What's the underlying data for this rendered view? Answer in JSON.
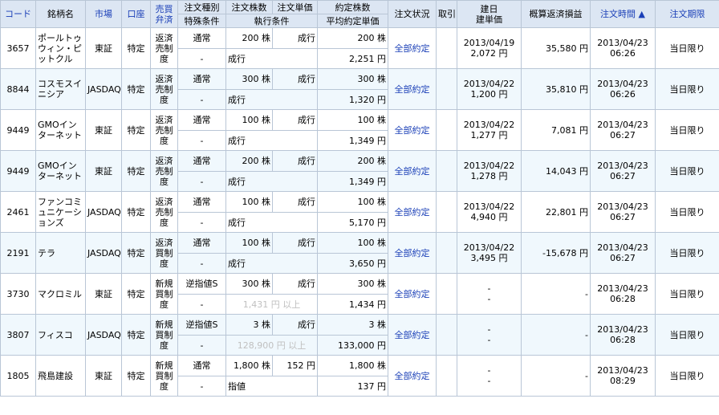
{
  "header": {
    "code": "コード",
    "name": "銘柄名",
    "market": "市場",
    "account": "口座",
    "trade": "売買弁済",
    "order_type": "注文種別",
    "order_qty": "注文株数",
    "order_price": "注文単価",
    "exec_qty": "約定株数",
    "status": "注文状況",
    "cancel": "取引",
    "open_date": "建日",
    "open_price": "建単価",
    "profit": "概算返済損益",
    "order_time": "注文時間 ▲",
    "expiry": "注文期限",
    "special": "特殊条件",
    "exec_cond": "執行条件",
    "avg_price": "平均約定単価"
  },
  "rows": [
    {
      "code": "3657",
      "name": "ポールトゥウィン・ピットクル",
      "market": "東証",
      "account": "特定",
      "trade": "返済売制度",
      "type": "通常",
      "qty": "200 株",
      "price": "成行",
      "exec_qty": "200 株",
      "special": "-",
      "cond": "成行",
      "avg": "2,251 円",
      "status": "全部約定",
      "open_date": "2013/04/19",
      "open_price": "2,072 円",
      "profit": "35,580 円",
      "time_d": "2013/04/23",
      "time_t": "06:26",
      "expiry": "当日限り"
    },
    {
      "code": "8844",
      "name": "コスモスイニシア",
      "market": "JASDAQ",
      "account": "特定",
      "trade": "返済売制度",
      "type": "通常",
      "qty": "300 株",
      "price": "成行",
      "exec_qty": "300 株",
      "special": "-",
      "cond": "成行",
      "avg": "1,320 円",
      "status": "全部約定",
      "open_date": "2013/04/22",
      "open_price": "1,200 円",
      "profit": "35,810 円",
      "time_d": "2013/04/23",
      "time_t": "06:26",
      "expiry": "当日限り"
    },
    {
      "code": "9449",
      "name": "GMOインターネット",
      "market": "東証",
      "account": "特定",
      "trade": "返済売制度",
      "type": "通常",
      "qty": "100 株",
      "price": "成行",
      "exec_qty": "100 株",
      "special": "-",
      "cond": "成行",
      "avg": "1,349 円",
      "status": "全部約定",
      "open_date": "2013/04/22",
      "open_price": "1,277 円",
      "profit": "7,081 円",
      "time_d": "2013/04/23",
      "time_t": "06:27",
      "expiry": "当日限り"
    },
    {
      "code": "9449",
      "name": "GMOインターネット",
      "market": "東証",
      "account": "特定",
      "trade": "返済売制度",
      "type": "通常",
      "qty": "200 株",
      "price": "成行",
      "exec_qty": "200 株",
      "special": "-",
      "cond": "成行",
      "avg": "1,349 円",
      "status": "全部約定",
      "open_date": "2013/04/22",
      "open_price": "1,278 円",
      "profit": "14,043 円",
      "time_d": "2013/04/23",
      "time_t": "06:27",
      "expiry": "当日限り"
    },
    {
      "code": "2461",
      "name": "ファンコミュニケーションズ",
      "market": "JASDAQ",
      "account": "特定",
      "trade": "返済売制度",
      "type": "通常",
      "qty": "100 株",
      "price": "成行",
      "exec_qty": "100 株",
      "special": "-",
      "cond": "成行",
      "avg": "5,170 円",
      "status": "全部約定",
      "open_date": "2013/04/22",
      "open_price": "4,940 円",
      "profit": "22,801 円",
      "time_d": "2013/04/23",
      "time_t": "06:27",
      "expiry": "当日限り"
    },
    {
      "code": "2191",
      "name": "テラ",
      "market": "JASDAQ",
      "account": "特定",
      "trade": "返済買制度",
      "type": "通常",
      "qty": "100 株",
      "price": "成行",
      "exec_qty": "100 株",
      "special": "-",
      "cond": "成行",
      "avg": "3,650 円",
      "status": "全部約定",
      "open_date": "2013/04/22",
      "open_price": "3,495 円",
      "profit": "-15,678 円",
      "time_d": "2013/04/23",
      "time_t": "06:27",
      "expiry": "当日限り"
    },
    {
      "code": "3730",
      "name": "マクロミル",
      "market": "東証",
      "account": "特定",
      "trade": "新規買制度",
      "type": "逆指値S",
      "qty": "300 株",
      "price": "成行",
      "exec_qty": "300 株",
      "special": "-",
      "cond": "1,431 円 以上",
      "cond_gray": true,
      "avg": "1,434 円",
      "status": "全部約定",
      "open_date": "-",
      "open_price": "-",
      "profit": "-",
      "time_d": "2013/04/23",
      "time_t": "06:28",
      "expiry": "当日限り"
    },
    {
      "code": "3807",
      "name": "フィスコ",
      "market": "JASDAQ",
      "account": "特定",
      "trade": "新規買制度",
      "type": "逆指値S",
      "qty": "3 株",
      "price": "成行",
      "exec_qty": "3 株",
      "special": "-",
      "cond": "128,900 円 以上",
      "cond_gray": true,
      "avg": "133,000 円",
      "status": "全部約定",
      "open_date": "-",
      "open_price": "-",
      "profit": "-",
      "time_d": "2013/04/23",
      "time_t": "06:28",
      "expiry": "当日限り"
    },
    {
      "code": "1805",
      "name": "飛島建設",
      "market": "東証",
      "account": "特定",
      "trade": "新規買制度",
      "type": "通常",
      "qty": "1,800 株",
      "price": "152 円",
      "exec_qty": "1,800 株",
      "special": "-",
      "cond": "指値",
      "avg": "137 円",
      "status": "全部約定",
      "open_date": "-",
      "open_price": "-",
      "profit": "-",
      "time_d": "2013/04/23",
      "time_t": "08:29",
      "expiry": "当日限り"
    }
  ]
}
